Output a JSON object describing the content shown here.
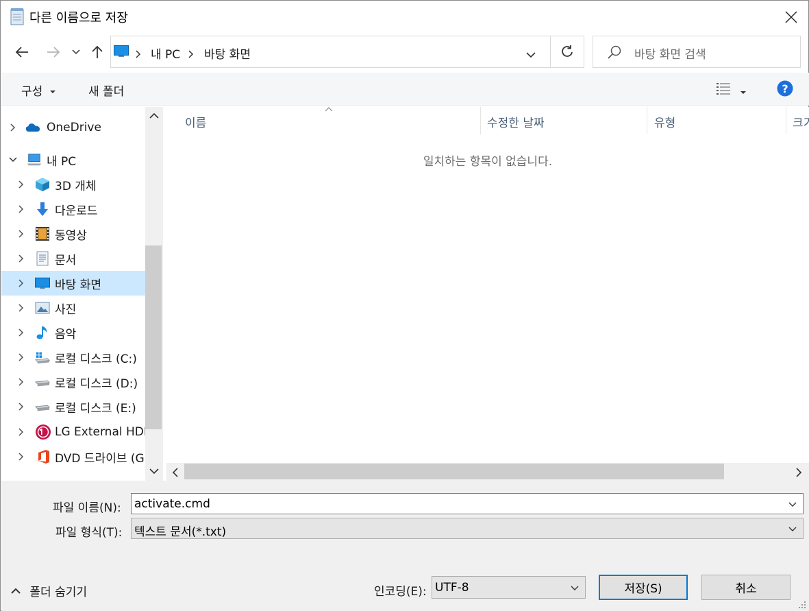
{
  "window": {
    "title": "다른 이름으로 저장"
  },
  "address": {
    "crumbs": [
      "내 PC",
      "바탕 화면"
    ]
  },
  "search": {
    "placeholder": "바탕 화면 검색"
  },
  "toolbar": {
    "organize_label": "구성",
    "new_folder_label": "새 폴더"
  },
  "nav_tree": {
    "items": [
      {
        "label": "OneDrive",
        "icon": "onedrive-cloud-icon",
        "expanded": false
      },
      {
        "label": "내 PC",
        "icon": "this-pc-icon",
        "expanded": true
      },
      {
        "label": "3D 개체",
        "icon": "3d-objects-icon"
      },
      {
        "label": "다운로드",
        "icon": "downloads-icon"
      },
      {
        "label": "동영상",
        "icon": "videos-icon"
      },
      {
        "label": "문서",
        "icon": "documents-icon"
      },
      {
        "label": "바탕 화면",
        "icon": "desktop-icon",
        "selected": true
      },
      {
        "label": "사진",
        "icon": "pictures-icon"
      },
      {
        "label": "음악",
        "icon": "music-icon"
      },
      {
        "label": "로컬 디스크 (C:)",
        "icon": "windows-drive-icon"
      },
      {
        "label": "로컬 디스크 (D:)",
        "icon": "drive-icon"
      },
      {
        "label": "로컬 디스크 (E:)",
        "icon": "drive-icon"
      },
      {
        "label": "LG External HDD",
        "icon": "lg-logo-icon"
      },
      {
        "label": "DVD 드라이브 (G",
        "icon": "office-icon"
      }
    ]
  },
  "file_list": {
    "columns": [
      "이름",
      "수정한 날짜",
      "유형",
      "크기"
    ],
    "empty_message": "일치하는 항목이 없습니다."
  },
  "form": {
    "filename_label": "파일 이름(N):",
    "filename_value": "activate.cmd",
    "filetype_label": "파일 형식(T):",
    "filetype_value": "텍스트 문서(*.txt)",
    "encoding_label": "인코딩(E):",
    "encoding_value": "UTF-8",
    "hide_folders_label": "폴더 숨기기",
    "save_label": "저장(S)",
    "cancel_label": "취소"
  },
  "colors": {
    "accent": "#0078d7",
    "selected_bg": "#cce8ff",
    "help": "#1e6fd9"
  }
}
